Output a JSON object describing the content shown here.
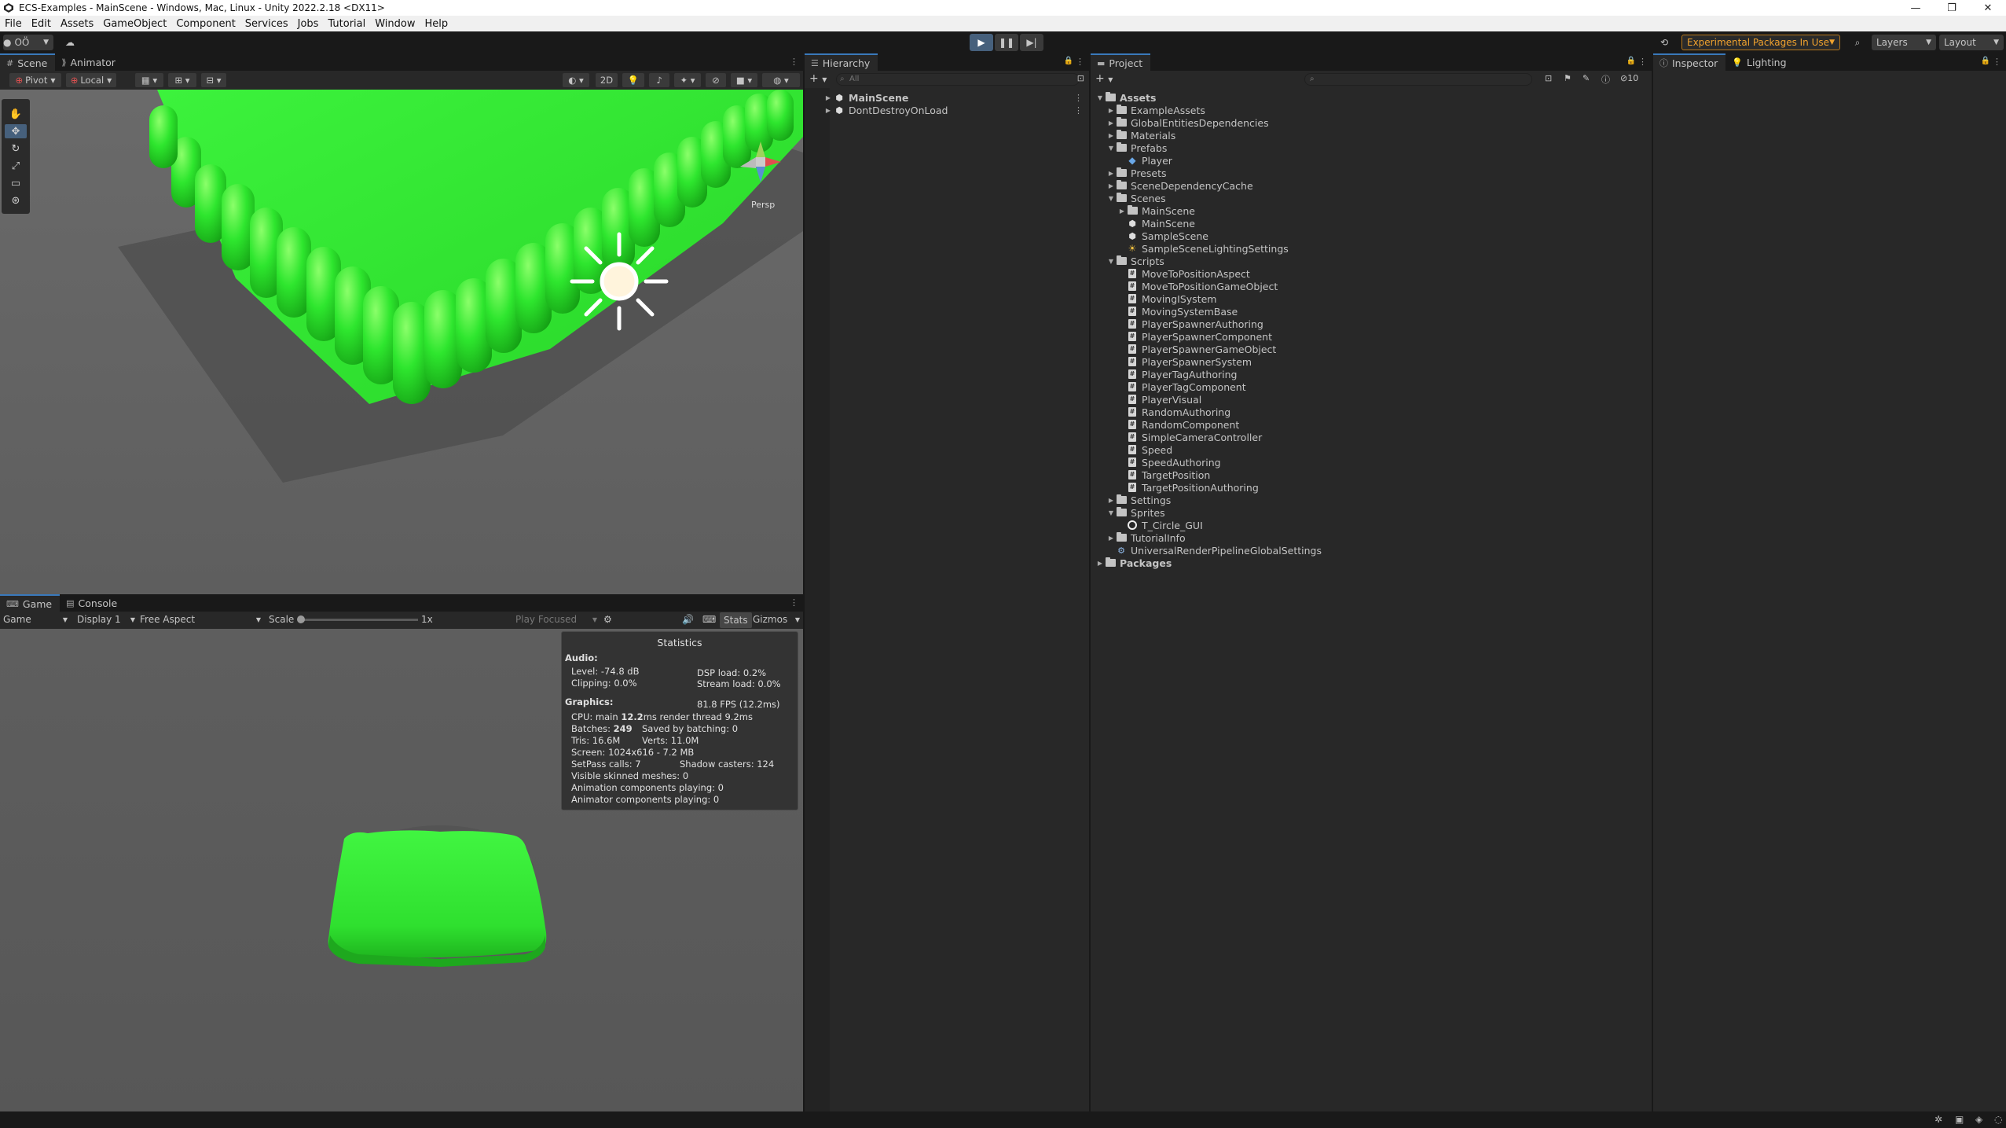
{
  "window": {
    "title": "ECS-Examples - MainScene - Windows, Mac, Linux - Unity 2022.2.18 <DX11>"
  },
  "menu": [
    "File",
    "Edit",
    "Assets",
    "GameObject",
    "Component",
    "Services",
    "Jobs",
    "Tutorial",
    "Window",
    "Help"
  ],
  "toolbar": {
    "account_label": "OÖ",
    "experimental_label": "Experimental Packages In Use",
    "layers_label": "Layers",
    "layout_label": "Layout"
  },
  "scene_panel": {
    "tabs": [
      "Scene",
      "Animator"
    ],
    "pivot_label": "Pivot",
    "local_label": "Local",
    "mode_2d_label": "2D",
    "persp_label": "Persp"
  },
  "game_panel": {
    "tabs": [
      "Game",
      "Console"
    ],
    "mode_label": "Game",
    "display_label": "Display 1",
    "aspect_label": "Free Aspect",
    "scale_label": "Scale",
    "scale_value": "1x",
    "play_focused_label": "Play Focused",
    "stats_label": "Stats",
    "gizmos_label": "Gizmos"
  },
  "statistics": {
    "title": "Statistics",
    "audio_header": "Audio:",
    "level": "Level: -74.8 dB",
    "dsp_load": "DSP load: 0.2%",
    "clipping": "Clipping: 0.0%",
    "stream_load": "Stream load: 0.0%",
    "graphics_header": "Graphics:",
    "fps": "81.8 FPS (12.2ms)",
    "cpu_prefix": "CPU: main",
    "cpu_main": "12.2",
    "cpu_suffix": "ms  render thread 9.2ms",
    "batches_prefix": "Batches:",
    "batches": "249",
    "batches_saved": "Saved by batching: 0",
    "tris": "Tris: 16.6M",
    "verts": "Verts: 11.0M",
    "screen": "Screen: 1024x616 - 7.2 MB",
    "setpass": "SetPass calls: 7",
    "shadow_casters": "Shadow casters: 124",
    "skinned_meshes": "Visible skinned meshes: 0",
    "animation_components": "Animation components playing: 0",
    "animator_components": "Animator components playing: 0"
  },
  "hierarchy": {
    "tab": "Hierarchy",
    "search_placeholder": "All",
    "items": [
      {
        "label": "MainScene"
      },
      {
        "label": "DontDestroyOnLoad"
      }
    ]
  },
  "project": {
    "tab": "Project",
    "hidden_count": "10",
    "tree": [
      {
        "label": "Assets",
        "type": "folder",
        "depth": 0,
        "expanded": true,
        "bold": true
      },
      {
        "label": "ExampleAssets",
        "type": "folder",
        "depth": 1,
        "expanded": false
      },
      {
        "label": "GlobalEntitiesDependencies",
        "type": "folder",
        "depth": 1,
        "expanded": false
      },
      {
        "label": "Materials",
        "type": "folder",
        "depth": 1,
        "expanded": false
      },
      {
        "label": "Prefabs",
        "type": "folder",
        "depth": 1,
        "expanded": true
      },
      {
        "label": "Player",
        "type": "prefab",
        "depth": 2
      },
      {
        "label": "Presets",
        "type": "folder",
        "depth": 1,
        "expanded": false
      },
      {
        "label": "SceneDependencyCache",
        "type": "folder",
        "depth": 1,
        "expanded": false
      },
      {
        "label": "Scenes",
        "type": "folder",
        "depth": 1,
        "expanded": true
      },
      {
        "label": "MainScene",
        "type": "folder",
        "depth": 2,
        "expanded": false
      },
      {
        "label": "MainScene",
        "type": "scene",
        "depth": 2
      },
      {
        "label": "SampleScene",
        "type": "scene",
        "depth": 2
      },
      {
        "label": "SampleSceneLightingSettings",
        "type": "lighting",
        "depth": 2
      },
      {
        "label": "Scripts",
        "type": "folder",
        "depth": 1,
        "expanded": true
      },
      {
        "label": "MoveToPositionAspect",
        "type": "script",
        "depth": 2
      },
      {
        "label": "MoveToPositionGameObject",
        "type": "script",
        "depth": 2
      },
      {
        "label": "MovingISystem",
        "type": "script",
        "depth": 2
      },
      {
        "label": "MovingSystemBase",
        "type": "script",
        "depth": 2
      },
      {
        "label": "PlayerSpawnerAuthoring",
        "type": "script",
        "depth": 2
      },
      {
        "label": "PlayerSpawnerComponent",
        "type": "script",
        "depth": 2
      },
      {
        "label": "PlayerSpawnerGameObject",
        "type": "script",
        "depth": 2
      },
      {
        "label": "PlayerSpawnerSystem",
        "type": "script",
        "depth": 2
      },
      {
        "label": "PlayerTagAuthoring",
        "type": "script",
        "depth": 2
      },
      {
        "label": "PlayerTagComponent",
        "type": "script",
        "depth": 2
      },
      {
        "label": "PlayerVisual",
        "type": "script",
        "depth": 2
      },
      {
        "label": "RandomAuthoring",
        "type": "script",
        "depth": 2
      },
      {
        "label": "RandomComponent",
        "type": "script",
        "depth": 2
      },
      {
        "label": "SimpleCameraController",
        "type": "script",
        "depth": 2
      },
      {
        "label": "Speed",
        "type": "script",
        "depth": 2
      },
      {
        "label": "SpeedAuthoring",
        "type": "script",
        "depth": 2
      },
      {
        "label": "TargetPosition",
        "type": "script",
        "depth": 2
      },
      {
        "label": "TargetPositionAuthoring",
        "type": "script",
        "depth": 2
      },
      {
        "label": "Settings",
        "type": "folder",
        "depth": 1,
        "expanded": false
      },
      {
        "label": "Sprites",
        "type": "folder",
        "depth": 1,
        "expanded": true
      },
      {
        "label": "T_Circle_GUI",
        "type": "sprite",
        "depth": 2
      },
      {
        "label": "TutorialInfo",
        "type": "folder",
        "depth": 1,
        "expanded": false
      },
      {
        "label": "UniversalRenderPipelineGlobalSettings",
        "type": "asset",
        "depth": 1
      },
      {
        "label": "Packages",
        "type": "folder",
        "depth": 0,
        "expanded": false,
        "bold": true
      }
    ]
  },
  "inspector": {
    "tabs": [
      "Inspector",
      "Lighting"
    ]
  },
  "colors": {
    "accent": "#46607c",
    "warning": "#f0a22e",
    "cube_green": "#2ff02f"
  }
}
